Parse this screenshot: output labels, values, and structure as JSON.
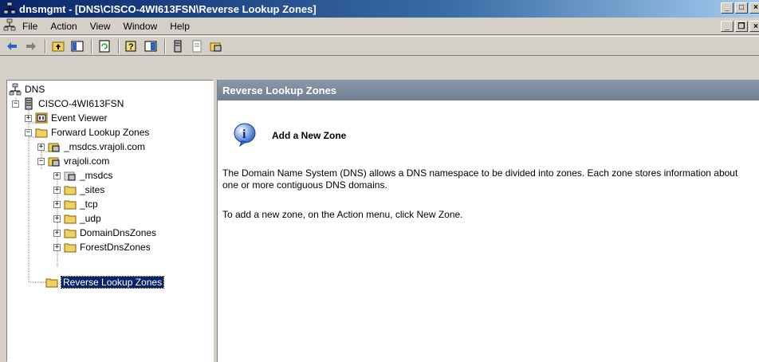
{
  "window": {
    "title": "dnsmgmt - [DNS\\CISCO-4WI613FSN\\Reverse Lookup Zones]",
    "icon": "dns-console-icon"
  },
  "menubar": {
    "items": [
      "File",
      "Action",
      "View",
      "Window",
      "Help"
    ]
  },
  "toolbar": {
    "buttons": [
      "back-icon",
      "forward-icon",
      "up-icon",
      "show-hide-tree-icon",
      "refresh-icon",
      "help-icon",
      "properties-icon",
      "server-icon",
      "zone-icon",
      "new-zone-icon"
    ]
  },
  "tree": {
    "root": "DNS",
    "server": "CISCO-4WI613FSN",
    "event_viewer": "Event Viewer",
    "forward_zones": "Forward Lookup Zones",
    "msdcs_zone": "_msdcs.vrajoli.com",
    "domain_zone": "vrajoli.com",
    "msdcs": "_msdcs",
    "sites": "_sites",
    "tcp": "_tcp",
    "udp": "_udp",
    "domain_dns_zones": "DomainDnsZones",
    "forest_dns_zones": "ForestDnsZones",
    "reverse_zones": "Reverse Lookup Zones"
  },
  "content": {
    "header": "Reverse Lookup Zones",
    "info_title": "Add a New Zone",
    "paragraph1": "The Domain Name System (DNS) allows a DNS namespace to be divided into zones. Each zone stores information about one or more contiguous DNS domains.",
    "paragraph2": "To add a new zone, on the Action menu, click New Zone."
  },
  "colors": {
    "title_bar": "#0a246a",
    "selection": "#0a246a",
    "header": "#7b8b9b"
  }
}
